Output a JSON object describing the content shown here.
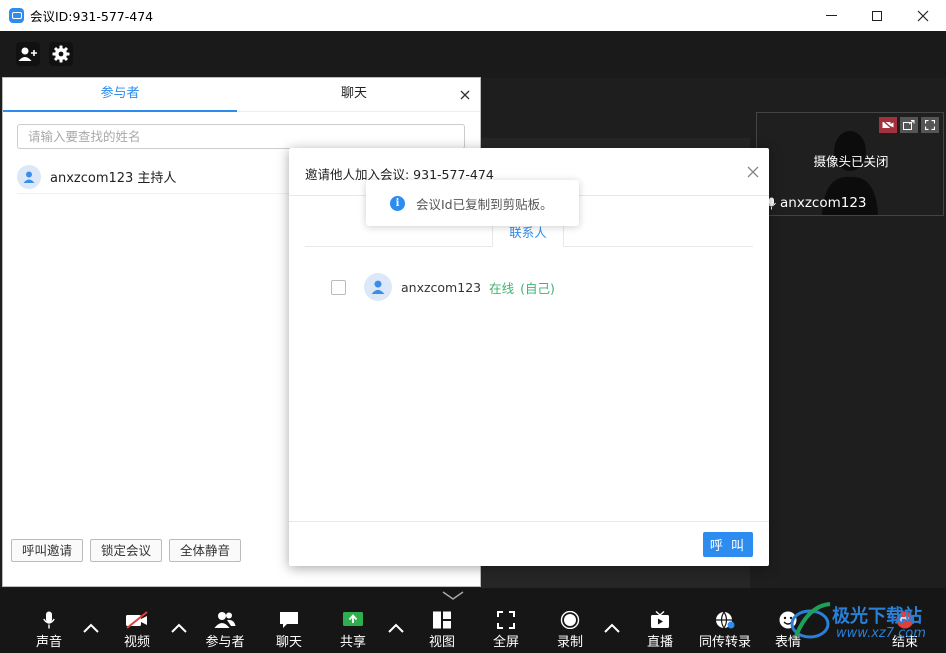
{
  "window": {
    "title": "会议ID:931-577-474"
  },
  "camera_tile": {
    "status": "摄像头已关闭",
    "name": "anxzcom123"
  },
  "participants_panel": {
    "tabs": [
      {
        "label": "参与者",
        "active": true
      },
      {
        "label": "聊天",
        "active": false
      }
    ],
    "search_placeholder": "请输入要查找的姓名",
    "participants": [
      {
        "name": "anxzcom123 主持人"
      }
    ],
    "buttons": {
      "invite": "呼叫邀请",
      "lock": "锁定会议",
      "mute_all": "全体静音"
    }
  },
  "invite_dialog": {
    "title": "邀请他人加入会议: 931-577-474",
    "tab": "联系人",
    "contacts": [
      {
        "name": "anxzcom123",
        "status": "在线",
        "self": "(自己)"
      }
    ],
    "call_button": "呼 叫"
  },
  "toast": {
    "message": "会议Id已复制到剪贴板。"
  },
  "toolbar": {
    "audio": "声音",
    "video": "视频",
    "participants": "参与者",
    "chat": "聊天",
    "share": "共享",
    "view": "视图",
    "fullscreen": "全屏",
    "record": "录制",
    "live": "直播",
    "transcribe": "同传转录",
    "emoji": "表情",
    "end": "结束"
  },
  "watermark": {
    "line1": "极光下载站",
    "line2": "www.xz7.com"
  },
  "colors": {
    "accent": "#2d8cf0",
    "online": "#3cb371",
    "end_red": "#e0413d",
    "share_green": "#2eae4e"
  }
}
